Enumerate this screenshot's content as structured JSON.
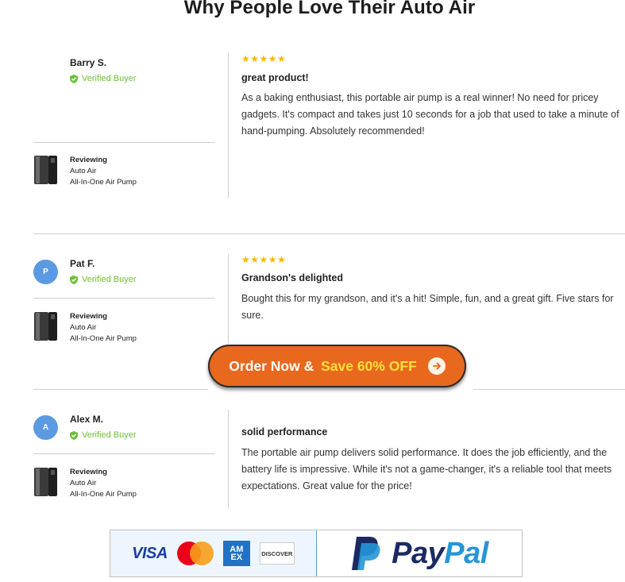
{
  "page": {
    "title": "Why People Love Their Auto Air"
  },
  "reviews": [
    {
      "avatar_letter": "",
      "name": "Barry S.",
      "verified_label": "Verified Buyer",
      "reviewing_label": "Reviewing",
      "product_line1": "Auto Air",
      "product_line2": "All-In-One Air Pump",
      "rating": 5,
      "stars": "★★★★★",
      "title": "great product!",
      "body": "As a baking enthusiast, this portable air pump is a real winner! No need for pricey gadgets. It's compact and takes just 10 seconds for a job that used to take a minute of hand-pumping. Absolutely recommended!"
    },
    {
      "avatar_letter": "P",
      "name": "Pat F.",
      "verified_label": "Verified Buyer",
      "reviewing_label": "Reviewing",
      "product_line1": "Auto Air",
      "product_line2": "All-In-One Air Pump",
      "rating": 5,
      "stars": "★★★★★",
      "title": "Grandson's delighted",
      "body": "Bought this for my grandson, and it's a hit! Simple, fun, and a great gift. Five stars for sure."
    },
    {
      "avatar_letter": "A",
      "name": "Alex M.",
      "verified_label": "Verified Buyer",
      "reviewing_label": "Reviewing",
      "product_line1": "Auto Air",
      "product_line2": "All-In-One Air Pump",
      "rating": null,
      "stars": "",
      "title": "solid performance",
      "body": "The portable air pump delivers solid performance. It does the job efficiently, and the battery life is impressive. While it's not a game-changer, it's a reliable tool that meets expectations. Great value for the price!"
    }
  ],
  "cta": {
    "label_plain": "Order Now & ",
    "label_highlight": "Save 60% OFF",
    "icon": "arrow-right-icon",
    "color": "#e8681e",
    "highlight_color": "#ffe13a"
  },
  "payments": {
    "visa": "VISA",
    "mastercard_icon": "mastercard-logo",
    "amex_line1": "AM",
    "amex_line2": "EX",
    "discover": "DISCOVER",
    "paypal_part1": "Pay",
    "paypal_part2": "Pal"
  },
  "colors": {
    "verified": "#6ebf3a",
    "star": "#f5b800",
    "avatar": "#5b9ae3"
  }
}
